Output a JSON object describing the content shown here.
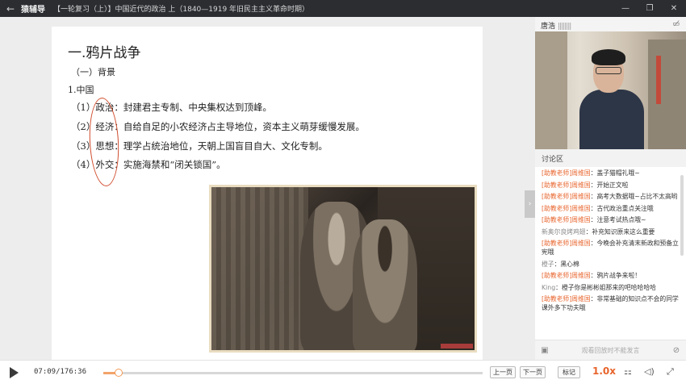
{
  "titlebar": {
    "app_name": "猿辅导",
    "title": "【一轮复习（上）】中国近代的政治 上（1840—1919 年旧民主主义革命时期）"
  },
  "slide": {
    "title": "一.鸦片战争",
    "subtitle": "（一）背景",
    "heading": "1.中国",
    "lines": [
      "（1）政治：封建君主专制、中央集权达到顶峰。",
      "（2）经济：自给自足的小农经济占主导地位，资本主义萌芽缓慢发展。",
      "（3）思想：理学占统治地位，天朝上国盲目自大、文化专制。",
      "（4）外交：实施海禁和“闭关锁国”。"
    ]
  },
  "camera": {
    "teacher_name": "唐浩"
  },
  "discussion": {
    "header": "讨论区",
    "messages": [
      {
        "name": "[助教老师]周维国",
        "text": "：盖子猫帽礼哦~"
      },
      {
        "name": "[助教老师]周维国",
        "text": "：开始正文啦"
      },
      {
        "name": "[助教老师]周维国",
        "text": "：高考大数据哦~占比不太高哟"
      },
      {
        "name": "[助教老师]周维国",
        "text": "：古代政治重点关注哦"
      },
      {
        "name": "[助教老师]周维国",
        "text": "：注意考试热点哦~"
      },
      {
        "name": "新奥尔良烤鸡翅",
        "text": "：补充知识原来这么重要",
        "guest": true
      },
      {
        "name": "[助教老师]周维国",
        "text": "：今晚会补充清末新政和预备立宪哦"
      },
      {
        "name": "橙子",
        "text": "：黑心棉",
        "guest": true
      },
      {
        "name": "[助教老师]周维国",
        "text": "：鸦片战争来啦！"
      },
      {
        "name": "King",
        "text": "：橙子你是彬彬姐那来的吧哈哈哈哈",
        "guest": true
      },
      {
        "name": "[助教老师]周维国",
        "text": "：非常基础的知识点不会的同学课外多下功夫哦"
      }
    ],
    "input_placeholder": "观看回放时不能发言"
  },
  "player": {
    "current_time": "07:09",
    "total_time": "/176:36",
    "progress": 0.04,
    "prev_label": "上一页",
    "next_label": "下一页",
    "mark_label": "标记",
    "speed": "1.0x"
  }
}
